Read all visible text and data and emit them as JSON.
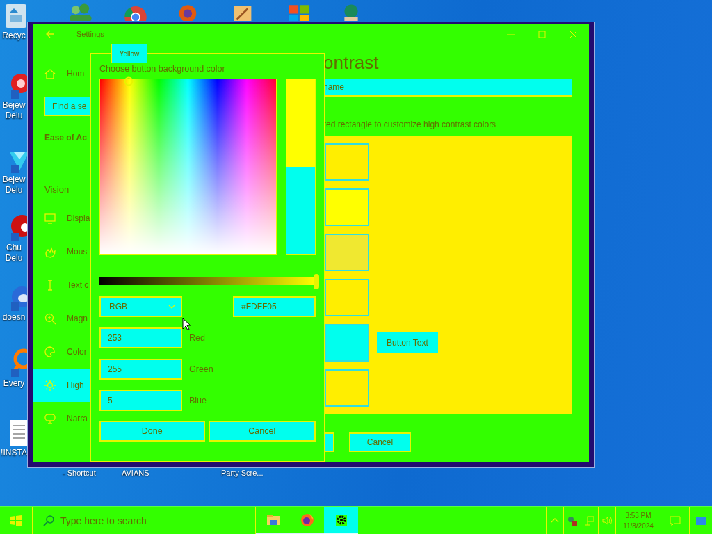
{
  "desktop": {
    "left_icons": [
      {
        "kind": "recycle",
        "lines": [
          "Recyc"
        ]
      },
      {
        "kind": "red-gem",
        "lines": [
          "Bejew",
          "Delu"
        ]
      },
      {
        "kind": "blue-gem",
        "lines": [
          "Bejew",
          "Delu"
        ]
      },
      {
        "kind": "red-disc",
        "lines": [
          "Chu",
          "Delu"
        ]
      },
      {
        "kind": "blue-drop",
        "lines": [
          "doesn"
        ]
      },
      {
        "kind": "magnifier",
        "lines": [
          "Every"
        ]
      },
      {
        "kind": "document",
        "lines": [
          "!INSTA"
        ]
      }
    ],
    "top_icons": [
      {
        "kind": "people"
      },
      {
        "kind": "chrome"
      },
      {
        "kind": "swirl"
      },
      {
        "kind": "paint"
      },
      {
        "kind": "shield"
      },
      {
        "kind": "figure"
      }
    ],
    "bottom_labels": [
      "- Shortcut",
      "AVIANS",
      "Party Scre..."
    ]
  },
  "settings_window": {
    "title": "Settings",
    "sidebar": {
      "home": "Hom",
      "search": {
        "placeholder": "Find a se"
      },
      "section": "Ease of Ac",
      "group": "Vision",
      "items": [
        {
          "kind": "display",
          "label": "Displa",
          "selected": false
        },
        {
          "kind": "mouse",
          "label": "Mous",
          "selected": false
        },
        {
          "kind": "text",
          "label": "Text c",
          "selected": false
        },
        {
          "kind": "magnifier",
          "label": "Magn",
          "selected": false
        },
        {
          "kind": "color",
          "label": "Color",
          "selected": false
        },
        {
          "kind": "contrast",
          "label": "High",
          "selected": true
        },
        {
          "kind": "narrator",
          "label": "Narra",
          "selected": false
        }
      ]
    },
    "heading": "ontrast",
    "theme_dropdown": {
      "value": "name"
    },
    "instruction": "red rectangle to customize high contrast colors",
    "preview": {
      "swatches": [
        {
          "color": "#ffee00"
        },
        {
          "color": "#ffff00"
        },
        {
          "color": "#f0e830"
        },
        {
          "color": "#ffee00"
        },
        {
          "color": "#00ffee",
          "button_text": "Button Text"
        },
        {
          "color": "#ffee00"
        }
      ]
    },
    "buttons": [
      {
        "kind": "partial"
      },
      {
        "kind": "labeled",
        "label": "Cancel"
      }
    ]
  },
  "color_dialog": {
    "tab": "Yellow",
    "title": "Choose button background color",
    "brightness": {
      "level": 1
    },
    "mode": {
      "value": "RGB"
    },
    "hex": {
      "value": "#FDFF05"
    },
    "channels": [
      {
        "label": "Red",
        "value": "253"
      },
      {
        "label": "Green",
        "value": "255"
      },
      {
        "label": "Blue",
        "value": "5"
      }
    ],
    "buttons": [
      "Done",
      "Cancel"
    ]
  },
  "taskbar": {
    "search": {
      "placeholder": "Type here to search"
    },
    "apps": [
      {
        "kind": "folder",
        "selected": false
      },
      {
        "kind": "firefox",
        "selected": false
      },
      {
        "kind": "gear",
        "selected": true
      }
    ],
    "clock": {
      "time": "3:53 PM",
      "date": "11/8/2024"
    }
  }
}
